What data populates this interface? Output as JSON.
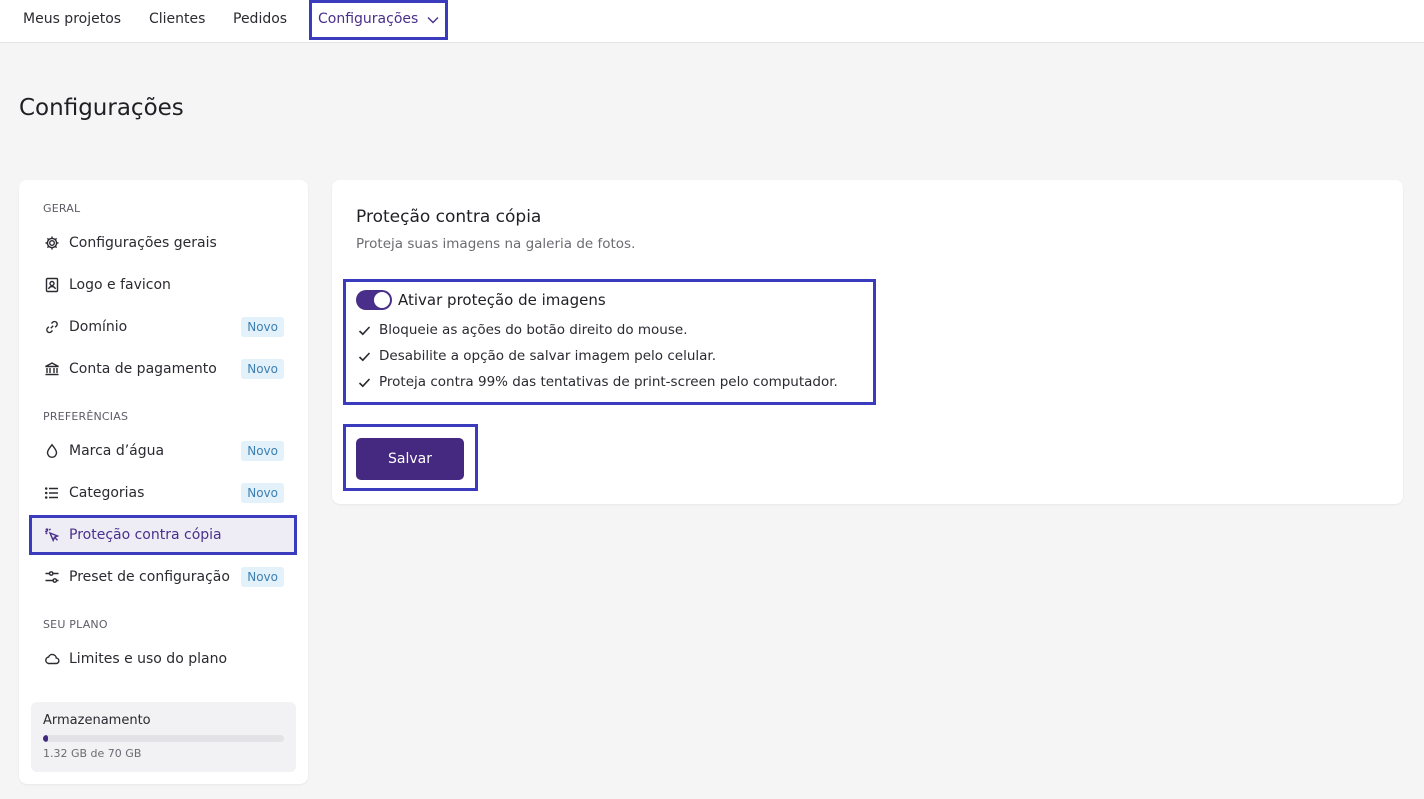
{
  "nav": {
    "items": [
      "Meus projetos",
      "Clientes",
      "Pedidos"
    ],
    "active": "Configurações"
  },
  "page": {
    "title": "Configurações"
  },
  "sidebar": {
    "sections": {
      "geral": "GERAL",
      "preferencias": "PREFERÊNCIAS",
      "plano": "SEU PLANO"
    },
    "items": [
      {
        "label": "Configurações gerais",
        "icon": "gear-icon"
      },
      {
        "label": "Logo e favicon",
        "icon": "image-badge-icon"
      },
      {
        "label": "Domínio",
        "icon": "link-icon",
        "badge": "Novo"
      },
      {
        "label": "Conta de pagamento",
        "icon": "bank-icon",
        "badge": "Novo"
      },
      {
        "label": "Marca d’água",
        "icon": "drop-icon",
        "badge": "Novo"
      },
      {
        "label": "Categorias",
        "icon": "list-icon",
        "badge": "Novo"
      },
      {
        "label": "Proteção contra cópia",
        "icon": "cursor-click-icon",
        "selected": true
      },
      {
        "label": "Preset de configuração",
        "icon": "sliders-icon",
        "badge": "Novo"
      },
      {
        "label": "Limites e uso do plano",
        "icon": "cloud-icon"
      }
    ],
    "storage": {
      "title": "Armazenamento",
      "text": "1.32 GB de 70 GB",
      "used_fraction": 0.019
    }
  },
  "main": {
    "title": "Proteção contra cópia",
    "subtitle": "Proteja suas imagens na galeria de fotos.",
    "toggle": {
      "label": "Ativar proteção de imagens",
      "on": true
    },
    "features": [
      "Bloqueie as ações do botão direito do mouse.",
      "Desabilite a opção de salvar imagem pelo celular.",
      "Proteja contra 99% das tentativas de print-screen pelo computador."
    ],
    "save_label": "Salvar"
  },
  "colors": {
    "accent": "#45287f",
    "highlight_border": "#3b3bbd",
    "badge_bg": "#e3f1fb",
    "badge_text": "#3d7fb0"
  }
}
